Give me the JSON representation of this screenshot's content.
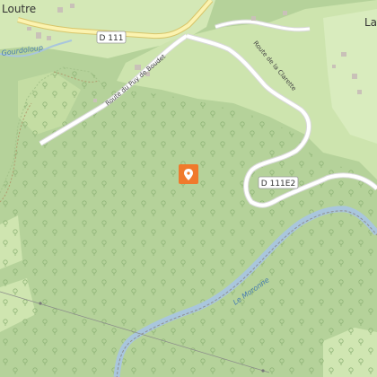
{
  "map": {
    "colors": {
      "forest": "#b5d29a",
      "meadow": "#cfe5b0",
      "water": "#a9c6dd",
      "water_label": "#4a7fb0",
      "road": "#ffffff",
      "road_casing": "#d8d8d8",
      "major_road": "#fbf3b0",
      "major_road_casing": "#d8c56a",
      "building": "#c9c1b8",
      "marker": "#f07a2c"
    },
    "labels": {
      "place_top_left": "Loutre",
      "place_top_right": "La",
      "d111": "D 111",
      "d111e2": "D 111E2",
      "road_puy_boudet": "Route du Puy de Boudet",
      "road_la_clarette": "Route de la Clarette",
      "stream_gourdoloup": "Gourdoloup",
      "river_moronne": "Le Moronne"
    },
    "marker": {
      "icon": "location-pin-icon"
    }
  }
}
